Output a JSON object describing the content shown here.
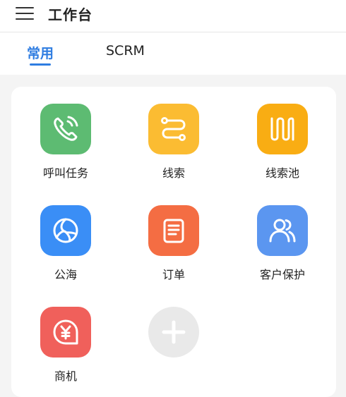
{
  "header": {
    "title": "工作台",
    "menu_icon": "hamburger-menu-icon"
  },
  "tabs": [
    {
      "label": "常用",
      "active": true
    },
    {
      "label": "SCRM",
      "active": false
    }
  ],
  "colors": {
    "accent": "#2f7de1",
    "call_task": "#5dbb72",
    "leads": "#fbbc32",
    "lead_pool": "#f9ad13",
    "public_sea": "#3a8ef6",
    "orders": "#f46d43",
    "customer_protect": "#5b96f0",
    "opportunity": "#f0605b",
    "add": "#e9e9e9"
  },
  "apps": [
    {
      "label": "呼叫任务",
      "icon": "phone-call-icon"
    },
    {
      "label": "线索",
      "icon": "route-icon"
    },
    {
      "label": "线索池",
      "icon": "lead-pool-icon"
    },
    {
      "label": "公海",
      "icon": "aperture-icon"
    },
    {
      "label": "订单",
      "icon": "document-icon"
    },
    {
      "label": "客户保护",
      "icon": "users-icon"
    },
    {
      "label": "商机",
      "icon": "yen-bubble-icon"
    }
  ],
  "add_button_icon": "plus-icon"
}
